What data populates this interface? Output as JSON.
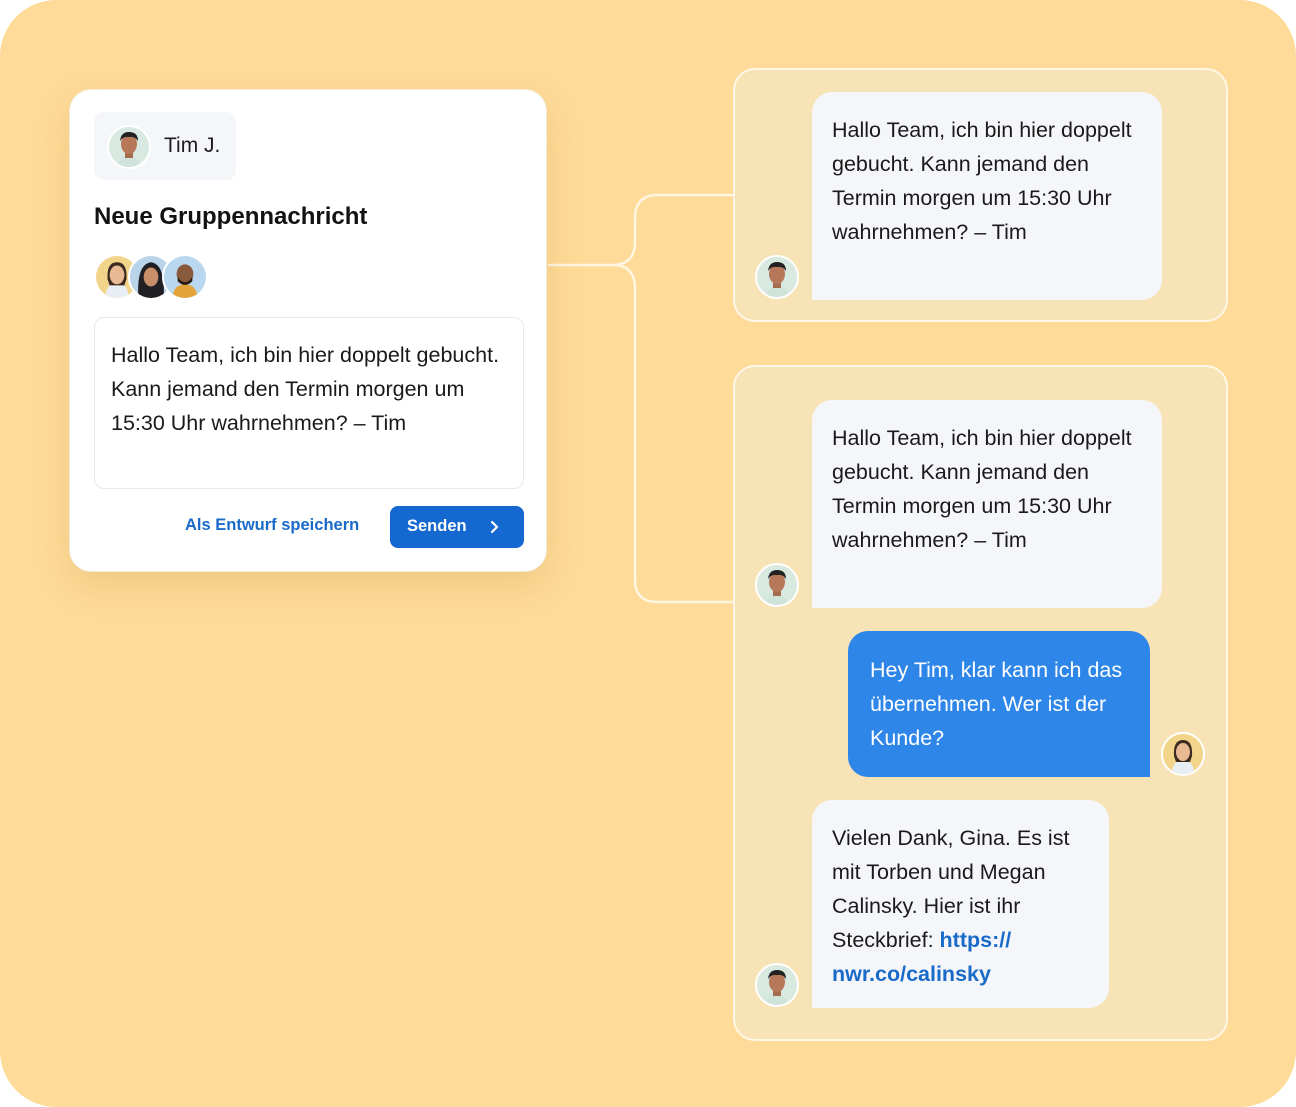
{
  "compose": {
    "sender_name": "Tim J.",
    "title": "Neue Gruppennachricht",
    "message": "Hallo Team, ich bin hier doppelt gebucht. Kann jemand den Termin morgen um 15:30 Uhr wahrnehmen? – Tim",
    "save_draft_label": "Als Entwurf speichern",
    "send_label": "Senden",
    "send_icon": "chevron-right-icon",
    "recipients": [
      "avatar-woman-light",
      "avatar-woman-hijab",
      "avatar-man-beard"
    ]
  },
  "panel_top": {
    "messages": [
      {
        "from": "Tim",
        "avatar": "avatar-tim",
        "text": "Hallo Team, ich bin hier doppelt gebucht. Kann jemand den Termin morgen um 15:30 Uhr wahrnehmen? – Tim"
      }
    ]
  },
  "panel_bottom": {
    "messages": [
      {
        "from": "Tim",
        "avatar": "avatar-tim",
        "text": "Hallo Team, ich bin hier doppelt gebucht. Kann jemand den Termin morgen um 15:30 Uhr wahrnehmen? – Tim"
      },
      {
        "from": "Gina",
        "avatar": "avatar-gina",
        "text": "Hey Tim, klar kann ich das übernehmen. Wer ist der Kunde?"
      },
      {
        "from": "Tim",
        "avatar": "avatar-tim",
        "text": "Vielen Dank, Gina. Es ist mit Torben und Megan Calinsky. Hier ist ihr Steckbrief: ",
        "link": "https://nwr.co/calinsky",
        "link_line1": "https://",
        "link_line2": "nwr.co/calinsky"
      }
    ]
  },
  "colors": {
    "background": "#fedb98",
    "panel": "#f7e3b6",
    "incoming_bubble": "#f4f6f9",
    "outgoing_bubble": "#2e86e8",
    "primary_button": "#1568d0",
    "link": "#1a6bc9"
  }
}
